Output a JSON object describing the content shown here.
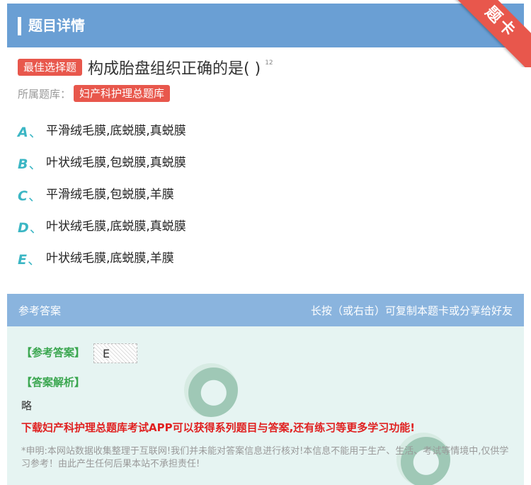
{
  "header": {
    "title": "题目详情"
  },
  "ribbon": {
    "label": "题卡"
  },
  "question": {
    "type_tag": "最佳选择题",
    "text": "构成胎盘组织正确的是( )",
    "sup": "12",
    "library_label": "所属题库：",
    "library_name": "妇产科护理总题库"
  },
  "options": [
    {
      "letter": "A",
      "sep": "、",
      "text": "平滑绒毛膜,底蜕膜,真蜕膜"
    },
    {
      "letter": "B",
      "sep": "、",
      "text": "叶状绒毛膜,包蜕膜,真蜕膜"
    },
    {
      "letter": "C",
      "sep": "、",
      "text": "平滑绒毛膜,包蜕膜,羊膜"
    },
    {
      "letter": "D",
      "sep": "、",
      "text": "叶状绒毛膜,底蜕膜,真蜕膜"
    },
    {
      "letter": "E",
      "sep": "、",
      "text": "叶状绒毛膜,底蜕膜,羊膜"
    }
  ],
  "answer_section": {
    "title": "参考答案",
    "hint": "长按（或右击）可复制本题卡或分享给好友",
    "answer_label": "【参考答案】",
    "answer_value": "E",
    "explanation_label": "【答案解析】",
    "explanation": "略",
    "promo": "下载妇产科护理总题库考试APP可以获得系列题目与答案,还有练习等更多学习功能!",
    "notice": "*申明:本网站数据收集整理于互联网!我们并未能对答案信息进行核对!本信息不能用于生产、生活、考试等情境中,仅供学习参考！由此产生任何后果本站不承担责任!"
  },
  "colors": {
    "header_bg": "#6a9fd4",
    "ribbon": "#e8574c",
    "tag_red": "#e8574c",
    "option_letter": "#3bb6c4",
    "answer_head_bg": "#8ab4de",
    "answer_body_bg": "#e6f4f2",
    "green_label": "#3aa64f",
    "promo_red": "#e02020"
  }
}
